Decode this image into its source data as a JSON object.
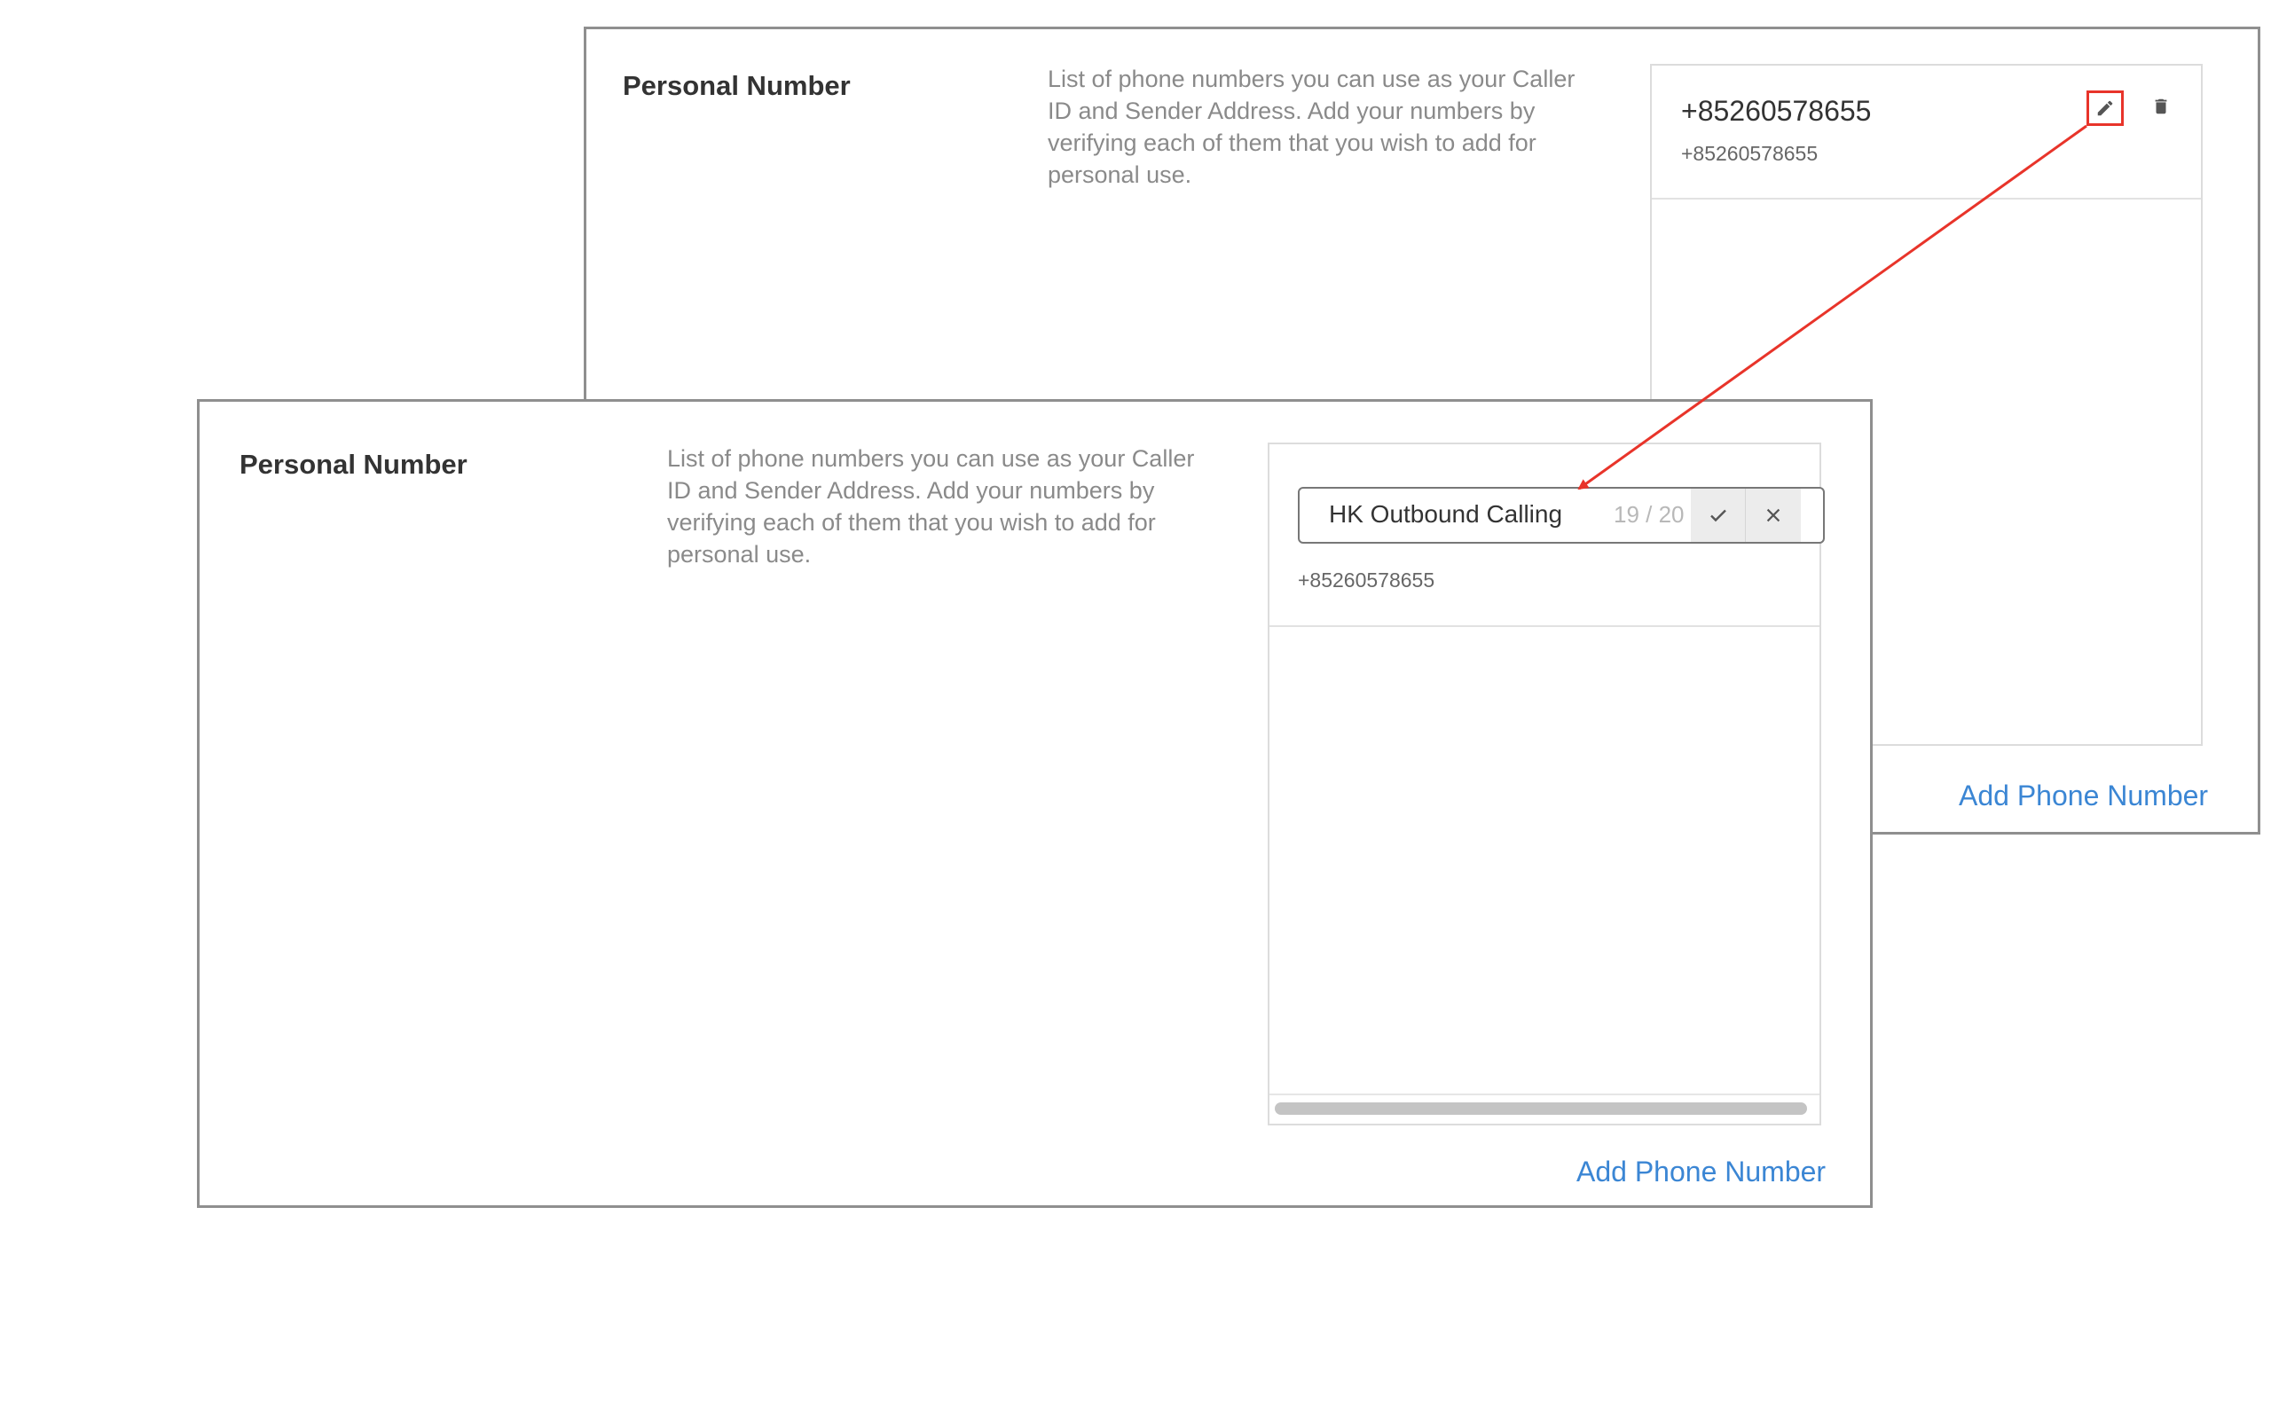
{
  "back_panel": {
    "title": "Personal Number",
    "description": "List of phone numbers you can use as your Caller ID and Sender Address. Add your numbers by verifying each of them that you wish to add for personal use.",
    "phone": {
      "name": "+85260578655",
      "number": "+85260578655"
    },
    "add_link": "Add Phone Number",
    "icons": {
      "edit": "edit-icon",
      "delete": "trash-icon"
    }
  },
  "front_panel": {
    "title": "Personal Number",
    "description": "List of phone numbers you can use as your Caller ID and Sender Address. Add your numbers by verifying each of them that you wish to add for personal use.",
    "edit_field": {
      "value": "HK Outbound Calling",
      "counter": "19 / 20"
    },
    "phone_number": "+85260578655",
    "add_link": "Add Phone Number",
    "icons": {
      "confirm": "check-icon",
      "cancel": "close-icon"
    }
  },
  "colors": {
    "annotation": "#e8342a",
    "link": "#3b86d4",
    "border": "#8f8f8f"
  }
}
